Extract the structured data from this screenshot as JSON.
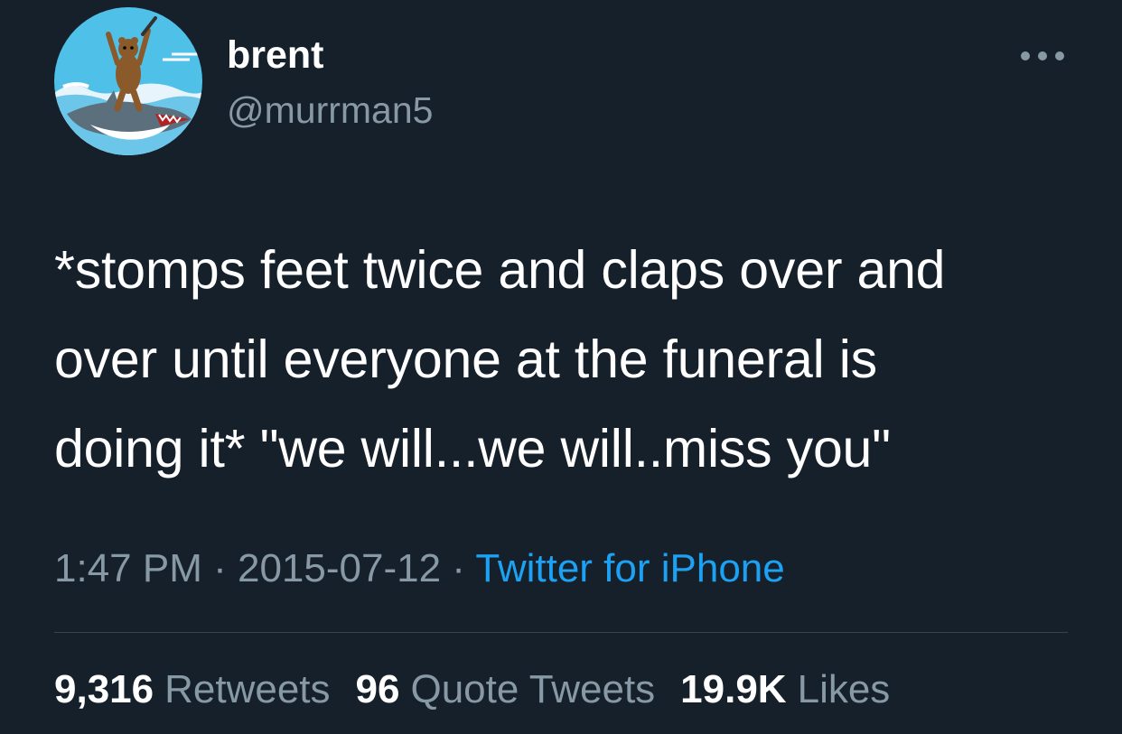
{
  "user": {
    "display_name": "brent",
    "handle": "@murrman5",
    "avatar_icon": "bear-riding-shark-avatar"
  },
  "more_icon": "more-options-icon",
  "tweet": {
    "text_lines": [
      "*stomps feet twice and claps over and",
      "over until everyone at the funeral is",
      "doing it* \"we will...we will..miss you\""
    ]
  },
  "meta": {
    "time": "1:47 PM",
    "separator": " · ",
    "date": "2015-07-12",
    "source": "Twitter for iPhone"
  },
  "stats": {
    "retweets": {
      "count": "9,316",
      "label": "Retweets"
    },
    "quote_tweets": {
      "count": "96",
      "label": "Quote Tweets"
    },
    "likes": {
      "count": "19.9K",
      "label": "Likes"
    }
  },
  "colors": {
    "background": "#15202b",
    "primary_text": "#ffffff",
    "secondary_text": "#8899a6",
    "link": "#1da1f2",
    "divider": "#38444d"
  }
}
